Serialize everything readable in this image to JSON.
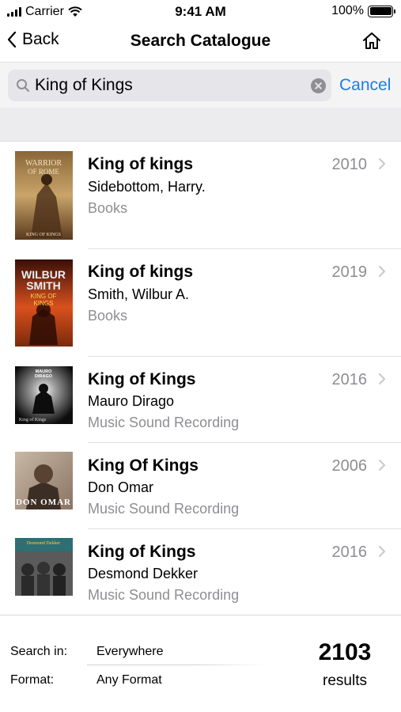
{
  "status_bar": {
    "carrier": "Carrier",
    "time": "9:41 AM",
    "battery": "100%",
    "icons": [
      "signal-icon",
      "wifi-icon",
      "battery-icon"
    ]
  },
  "nav": {
    "back_label": "Back",
    "title": "Search Catalogue",
    "home_icon": "home-icon"
  },
  "search": {
    "query": "King of Kings",
    "cancel_label": "Cancel"
  },
  "results": [
    {
      "title": "King of kings",
      "author": "Sidebottom, Harry.",
      "format": "Books",
      "year": "2010",
      "cover_text": [
        "WARRIOR",
        "OF ROME",
        "KING OF KINGS"
      ],
      "cover_colors": [
        "#6e4a2a",
        "#c9a56a"
      ]
    },
    {
      "title": "King of kings",
      "author": "Smith, Wilbur A.",
      "format": "Books",
      "year": "2019",
      "cover_text": [
        "WILBUR",
        "SMITH",
        "KING OF",
        "KINGS"
      ],
      "cover_colors": [
        "#3a0f08",
        "#d9501e"
      ]
    },
    {
      "title": "King of Kings",
      "author": "Mauro Dirago",
      "format": "Music Sound Recording",
      "year": "2016",
      "cover_text": [
        "MAURO",
        "DIRAGO",
        "King of Kings"
      ],
      "cover_colors": [
        "#0d0d0d",
        "#dcdcdc"
      ]
    },
    {
      "title": "King Of Kings",
      "author": "Don Omar",
      "format": "Music Sound Recording",
      "year": "2006",
      "cover_text": [
        "DON OMAR"
      ],
      "cover_colors": [
        "#3c2e24",
        "#c8b8a6"
      ]
    },
    {
      "title": "King of Kings",
      "author": "Desmond Dekker",
      "format": "Music Sound Recording",
      "year": "2016",
      "cover_text": [
        "Desmond Dekker"
      ],
      "cover_colors": [
        "#2d6f73",
        "#4a4a4a"
      ]
    }
  ],
  "footer": {
    "search_in_label": "Search in:",
    "search_in_value": "Everywhere",
    "format_label": "Format:",
    "format_value": "Any Format",
    "count": "2103",
    "count_label": "results"
  },
  "colors": {
    "accent": "#1a7ee8",
    "secondary_text": "#8e8e93",
    "search_field_bg": "#e5e5ea"
  }
}
